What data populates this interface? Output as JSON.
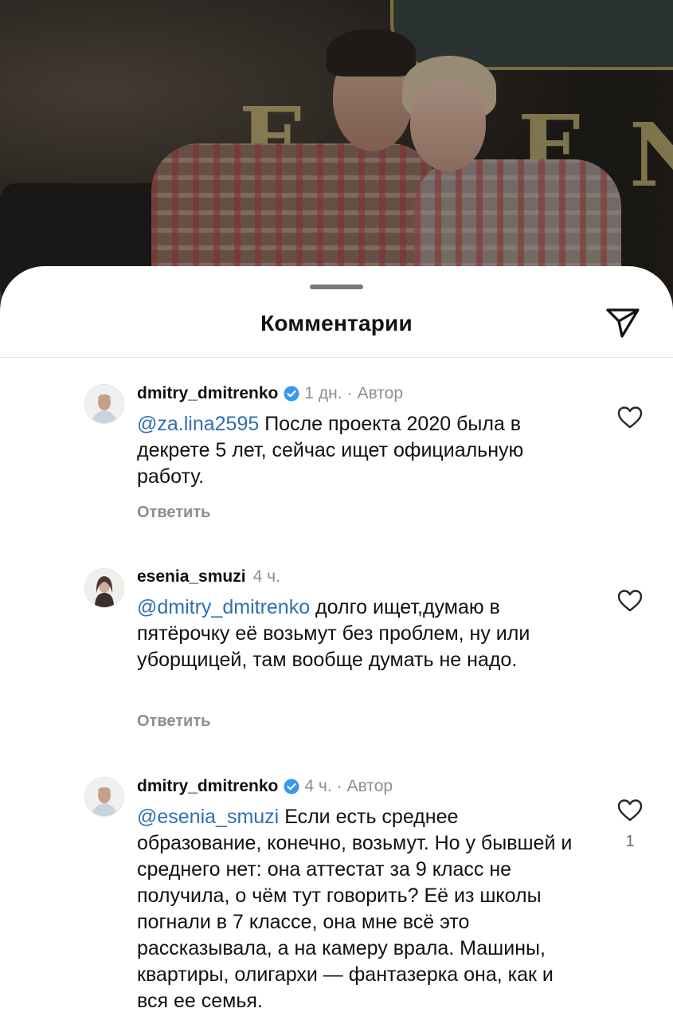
{
  "sheet": {
    "title": "Комментарии"
  },
  "comments": [
    {
      "username": "dmitry_dmitrenko",
      "verified": true,
      "time": "1 дн.",
      "separator": "·",
      "author_label": "Автор",
      "mention": "@za.lina2595",
      "text": " После проекта 2020 была в декрете 5 лет, сейчас ищет официальную работу.",
      "reply_label": "Ответить",
      "like_icon": "heart-outline-icon"
    },
    {
      "username": "esenia_smuzi",
      "verified": false,
      "time": "4 ч.",
      "mention": "@dmitry_dmitrenko",
      "text": " долго ищет,думаю в пятёрочку её возьмут без проблем, ну или уборщицей, там вообще думать не надо.",
      "reply_label": "Ответить",
      "like_icon": "heart-outline-icon"
    },
    {
      "username": "dmitry_dmitrenko",
      "verified": true,
      "time": "4 ч.",
      "separator": "·",
      "author_label": "Автор",
      "mention": "@esenia_smuzi",
      "text": " Если есть среднее образование, конечно, возьмут. Но у бывшей и среднего нет: она аттестат за 9 класс не получила, о чём тут говорить? Её из школы погнали в 7 классе, она мне всё это рассказывала, а на камеру врала. Машины, квартиры, олигархи — фантазерка она, как и вся ее семья.",
      "like_count": "1",
      "like_icon": "heart-outline-icon"
    }
  ],
  "colors": {
    "mention": "#2f6fb0",
    "verified": "#3897f0",
    "muted": "#8e8e8e"
  }
}
